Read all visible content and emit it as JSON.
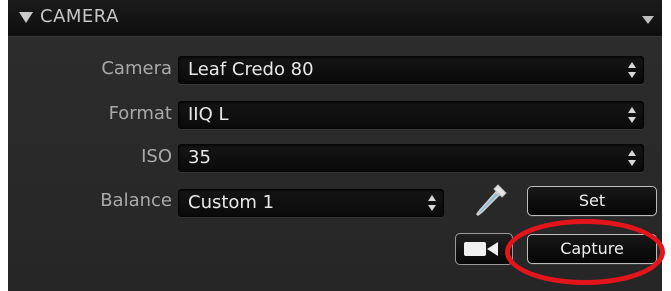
{
  "panel": {
    "title": "CAMERA",
    "fields": {
      "camera": {
        "label": "Camera",
        "value": "Leaf Credo 80"
      },
      "format": {
        "label": "Format",
        "value": "IIQ L"
      },
      "iso": {
        "label": "ISO",
        "value": "35"
      },
      "balance": {
        "label": "Balance",
        "value": "Custom 1"
      }
    },
    "buttons": {
      "set": "Set",
      "capture": "Capture"
    }
  },
  "colors": {
    "panel_bg": "#2a2a2a",
    "header_bg": "#111111",
    "annotation_ring": "#e4141b"
  },
  "icons": {
    "header_toggle": "triangle-down-icon",
    "panel_menu": "menu-triangle-icon",
    "picker": "eyedropper-icon",
    "live_view": "video-camera-icon"
  }
}
